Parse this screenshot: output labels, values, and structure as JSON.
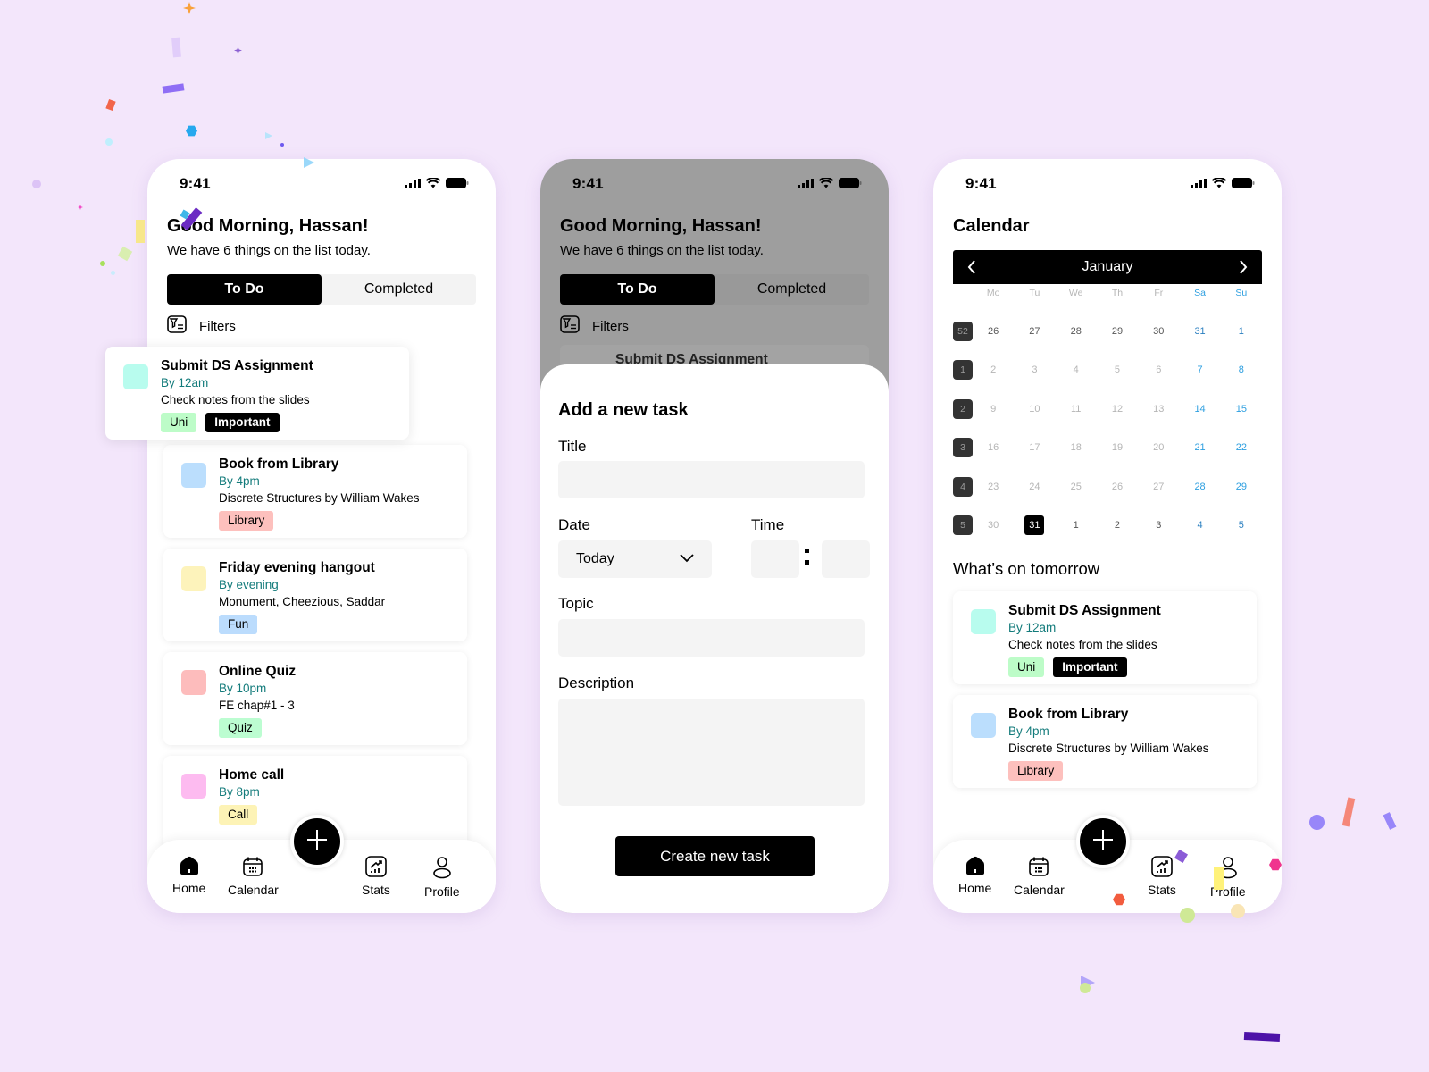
{
  "status_bar": {
    "time": "9:41"
  },
  "home": {
    "greeting": "Good Morning, Hassan!",
    "subtitle": "We have 6 things on the list today.",
    "tabs": [
      {
        "label": "To Do",
        "active": true
      },
      {
        "label": "Completed",
        "active": false
      }
    ],
    "filters_label": "Filters",
    "tasks": [
      {
        "title": "Submit DS Assignment",
        "due": "By 12am",
        "desc": "Check notes from the slides",
        "color": "#b8fcee",
        "tags": [
          {
            "label": "Uni",
            "bg": "#bdfcc8",
            "dark": false
          },
          {
            "label": "Important",
            "bg": "#000000",
            "dark": true
          }
        ]
      },
      {
        "title": "Book from Library",
        "due": "By 4pm",
        "desc": "Discrete Structures by William Wakes",
        "color": "#bbdefd",
        "tags": [
          {
            "label": "Library",
            "bg": "#fdc0bd",
            "dark": false
          }
        ]
      },
      {
        "title": "Friday evening hangout",
        "due": "By evening",
        "desc": "Monument, Cheezious, Saddar",
        "color": "#fdf3bb",
        "tags": [
          {
            "label": "Fun",
            "bg": "#bbdcfd",
            "dark": false
          }
        ]
      },
      {
        "title": "Online Quiz",
        "due": "By 10pm",
        "desc": "FE chap#1 - 3",
        "color": "#fdbcbc",
        "tags": [
          {
            "label": "Quiz",
            "bg": "#bcfdd1",
            "dark": false
          }
        ]
      },
      {
        "title": "Home call",
        "due": "By 8pm",
        "desc": "",
        "color": "#fdbbf0",
        "tags": [
          {
            "label": "Call",
            "bg": "#fdf3b6",
            "dark": false
          }
        ]
      }
    ]
  },
  "nav": {
    "items": [
      {
        "label": "Home"
      },
      {
        "label": "Calendar"
      },
      {
        "label": "Stats"
      },
      {
        "label": "Profile"
      }
    ]
  },
  "add_task": {
    "peek_title": "Submit DS Assignment",
    "title": "Add a new task",
    "title_label": "Title",
    "title_value": "",
    "date_label": "Date",
    "date_value": "Today",
    "time_label": "Time",
    "time_hour": "",
    "time_minute": "",
    "topic_label": "Topic",
    "topic_value": "",
    "description_label": "Description",
    "description_value": "",
    "create_label": "Create new task"
  },
  "calendar": {
    "title": "Calendar",
    "month": "January",
    "weekdays": [
      "Mo",
      "Tu",
      "We",
      "Th",
      "Fr",
      "Sa",
      "Su"
    ],
    "weeks": [
      {
        "week": "52",
        "days": [
          "26",
          "27",
          "28",
          "29",
          "30",
          "31",
          "1"
        ],
        "current": [
          true,
          true,
          true,
          true,
          true,
          true,
          true
        ]
      },
      {
        "week": "1",
        "days": [
          "2",
          "3",
          "4",
          "5",
          "6",
          "7",
          "8"
        ],
        "current": [
          false,
          false,
          false,
          false,
          false,
          false,
          false
        ]
      },
      {
        "week": "2",
        "days": [
          "9",
          "10",
          "11",
          "12",
          "13",
          "14",
          "15"
        ],
        "current": [
          false,
          false,
          false,
          false,
          false,
          false,
          false
        ]
      },
      {
        "week": "3",
        "days": [
          "16",
          "17",
          "18",
          "19",
          "20",
          "21",
          "22"
        ],
        "current": [
          false,
          false,
          false,
          false,
          false,
          false,
          false
        ]
      },
      {
        "week": "4",
        "days": [
          "23",
          "24",
          "25",
          "26",
          "27",
          "28",
          "29"
        ],
        "current": [
          false,
          false,
          false,
          false,
          false,
          false,
          false
        ]
      },
      {
        "week": "5",
        "days": [
          "30",
          "31",
          "1",
          "2",
          "3",
          "4",
          "5"
        ],
        "current": [
          false,
          true,
          true,
          true,
          true,
          true,
          true
        ]
      }
    ],
    "selected": {
      "week_index": 5,
      "day_index": 1,
      "label": "31"
    },
    "tomorrow_label": "What’s on tomorrow",
    "tomorrow_tasks": [
      0,
      1
    ]
  },
  "colors": {
    "background": "#f3e6fb",
    "accent": "#000000",
    "due_text": "#137b7b",
    "weekend": "#2d9fe0"
  }
}
